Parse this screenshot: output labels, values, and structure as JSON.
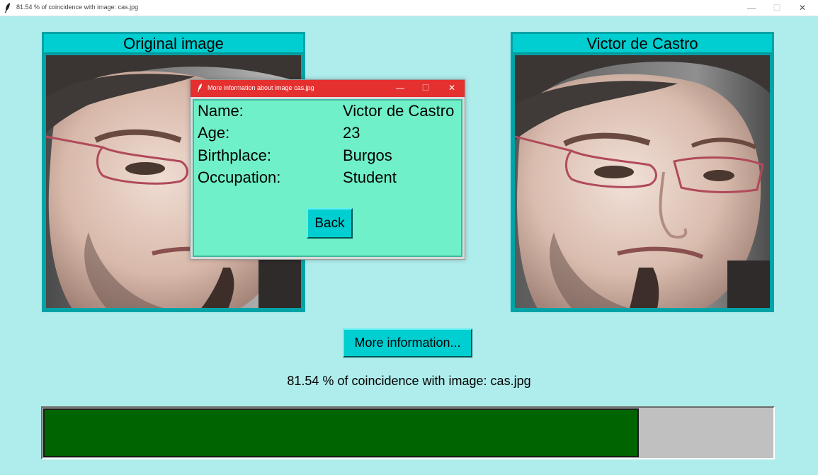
{
  "window": {
    "title": "81.54 % of coincidence with image: cas.jpg",
    "controls": {
      "minimize": "—",
      "maximize": "☐",
      "close": "✕"
    }
  },
  "left_panel": {
    "header": "Original image"
  },
  "right_panel": {
    "header": "Victor de Castro"
  },
  "popup": {
    "title": "More information about image cas.jpg",
    "controls": {
      "minimize": "—",
      "maximize": "☐",
      "close": "✕"
    },
    "fields": [
      {
        "label": "Name:",
        "value": "Victor de Castro"
      },
      {
        "label": "Age:",
        "value": "23"
      },
      {
        "label": "Birthplace:",
        "value": "Burgos"
      },
      {
        "label": "Occupation:",
        "value": "Student"
      }
    ],
    "back_label": "Back"
  },
  "more_info_label": "More information...",
  "coincidence_text": "81.54 % of coincidence with image: cas.jpg",
  "progress": {
    "percent": 81.54
  },
  "colors": {
    "background": "#afecec",
    "accent": "#00ced1",
    "popup_title": "#e53030",
    "popup_body": "#70f0c8",
    "progress_fill": "#006400",
    "progress_track": "#c0c0c0"
  },
  "icons": {
    "app": "feather-icon"
  }
}
